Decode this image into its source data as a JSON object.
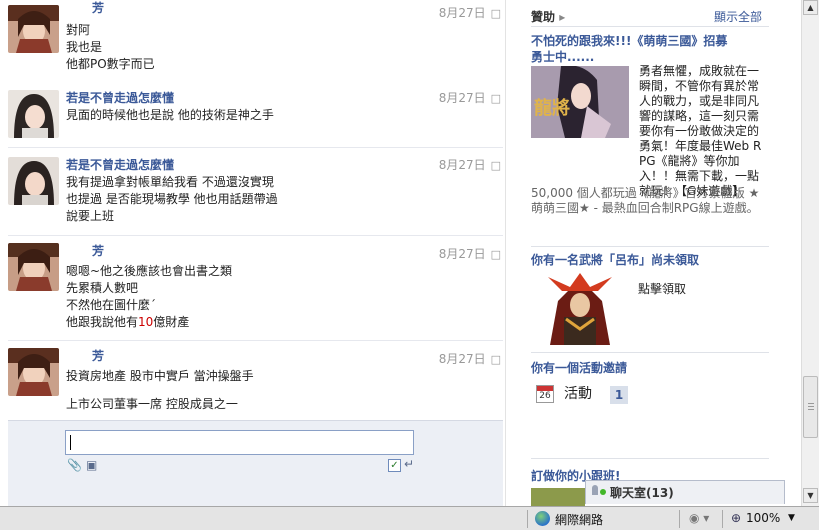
{
  "feed": [
    {
      "author": "芳",
      "date": "8月27日",
      "lines": [
        "對阿",
        "我也是",
        "他都PO數字而已"
      ]
    },
    {
      "author": "若是不曾走過怎麼懂",
      "date": "8月27日",
      "lines": [
        "見面的時候他也是說 他的技術是神之手"
      ]
    },
    {
      "author": "若是不曾走過怎麼懂",
      "date": "8月27日",
      "lines": [
        "我有提過拿對帳單給我看 不過還沒實現",
        "也提過 是否能現場教學 他也用話題帶過",
        "說要上班"
      ]
    },
    {
      "author": "芳",
      "date": "8月27日",
      "lines": [
        "嗯嗯~他之後應該也會出書之類",
        "先累積人數吧",
        "不然他在圖什麼ˊ",
        "他跟我說他有"
      ],
      "line4_value": "10",
      "line4_suffix": "億財產"
    },
    {
      "author": "芳",
      "date": "8月27日",
      "lines": [
        "投資房地產 股市中實戶 當沖操盤手",
        "",
        "上市公司董事一席 控股成員之一"
      ]
    }
  ],
  "sponsor": {
    "header": "贊助",
    "show_all": "顯示全部",
    "ad1": {
      "title": "不怕死的跟我來!!!《萌萌三國》招募勇士中......",
      "image_text": "龍將",
      "desc": "勇者無懼，成敗就在一瞬間，不管你有異於常人的戰力，或是非同凡響的謀略，這一刻只需要你有一份敢做決定的勇氣！年度最佳Web RPG《龍將》等你加入！！無需下載，一點就玩！【G妹遊戲】",
      "stats": "50,000 個人都玩過《龍將》官方繁體版 ★萌萌三國★ - 最熱血回合制RPG線上遊戲。"
    },
    "ad2": {
      "title": "你有一名武將「呂布」尚未領取",
      "cta": "點擊領取"
    },
    "ad3": {
      "title": "你有一個活動邀請",
      "cal_day": "26",
      "label": "活動",
      "count": "1"
    },
    "ad4": {
      "title": "訂做你的小跟班!"
    }
  },
  "chat": {
    "label": "聊天室",
    "count": "(13)"
  },
  "statusbar": {
    "zone": "網際網路",
    "zoom": "100%"
  }
}
